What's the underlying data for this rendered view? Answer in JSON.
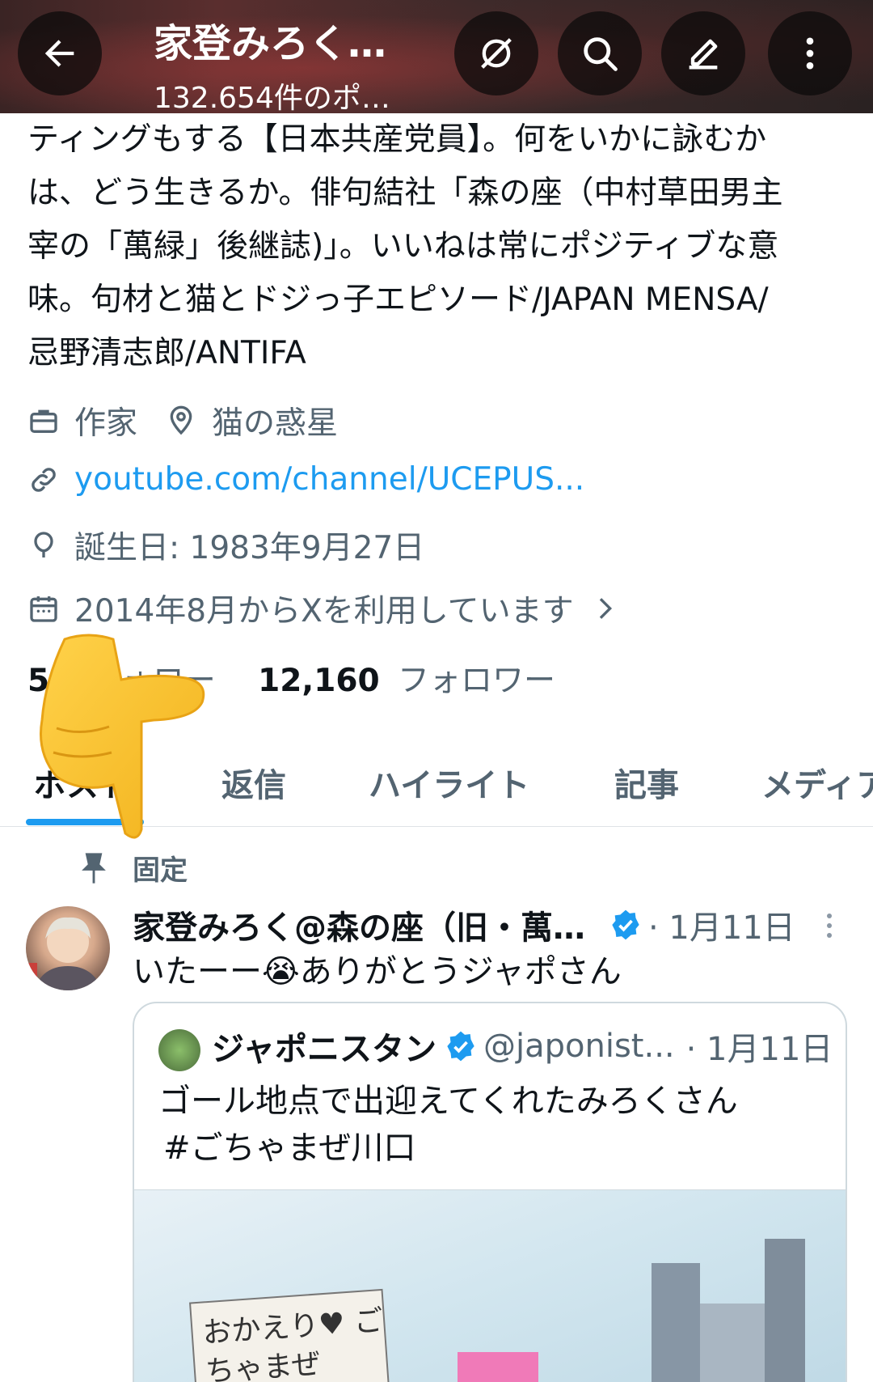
{
  "header": {
    "title": "家登みろく…",
    "subtitle": "132.654件のポ…"
  },
  "bio": {
    "lines": [
      "ティングもする【日本共産党員】。何をいかに詠むか",
      "は、どう生きるか。俳句結社「森の座（中村草田男主",
      "宰の「萬緑」後継誌)」。いいねは常にポジティブな意",
      "味。句材と猫とドジっ子エピソード/JAPAN MENSA/",
      "忌野清志郎/ANTIFA"
    ]
  },
  "profile": {
    "job": "作家",
    "location": "猫の惑星",
    "link": "youtube.com/channel/UCEPUS...",
    "birthday": "誕生日: 1983年9月27日",
    "joined": "2014年8月からXを利用しています",
    "following_count": "50",
    "following_label": "フォロー",
    "followers_count": "12,160",
    "followers_label": "フォロワー"
  },
  "tabs": [
    {
      "label": "ポスト"
    },
    {
      "label": "返信"
    },
    {
      "label": "ハイライト"
    },
    {
      "label": "記事"
    },
    {
      "label": "メディア"
    }
  ],
  "pinned_label": "固定",
  "post": {
    "author": "家登みろく@森の座（旧・萬…",
    "date": "· 1月11日",
    "text": "いたーー😭ありがとうジャポさん",
    "quote": {
      "author": "ジャポニスタン",
      "handle": "@japonist...",
      "date": "· 1月11日",
      "text_line1": "ゴール地点で出迎えてくれたみろくさん",
      "text_line2": "#ごちゃまぜ川口",
      "image_sign": "おかえり♥ ごちゃまぜ"
    }
  },
  "colors": {
    "accent": "#1d9bf0",
    "muted": "#536471",
    "text": "#0f1419"
  }
}
